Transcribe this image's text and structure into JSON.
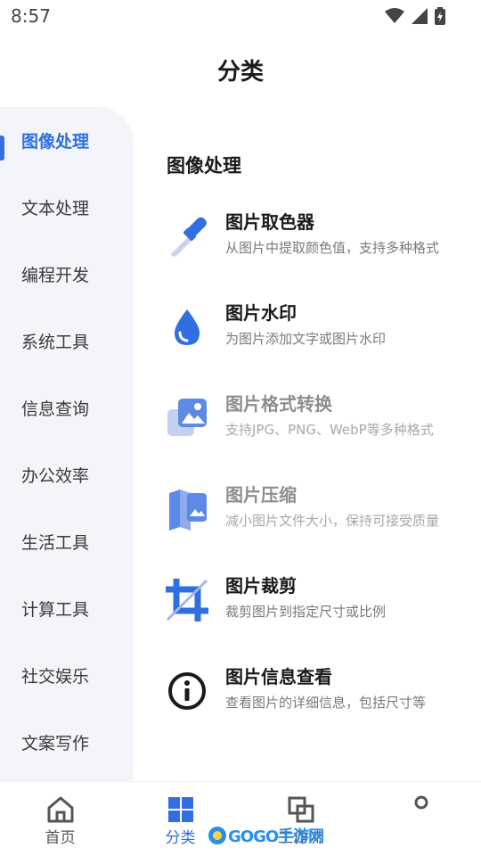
{
  "status_bar": {
    "time": "8:57"
  },
  "header": {
    "title": "分类"
  },
  "sidebar": {
    "items": [
      {
        "label": "图像处理",
        "active": true
      },
      {
        "label": "文本处理"
      },
      {
        "label": "编程开发"
      },
      {
        "label": "系统工具"
      },
      {
        "label": "信息查询"
      },
      {
        "label": "办公效率"
      },
      {
        "label": "生活工具"
      },
      {
        "label": "计算工具"
      },
      {
        "label": "社交娱乐"
      },
      {
        "label": "文案写作"
      }
    ]
  },
  "main": {
    "section_title": "图像处理",
    "tools": [
      {
        "title": "图片取色器",
        "desc": "从图片中提取颜色值，支持多种格式",
        "icon": "color-picker-icon"
      },
      {
        "title": "图片水印",
        "desc": "为图片添加文字或图片水印",
        "icon": "water-drop-icon"
      },
      {
        "title": "图片格式转换",
        "desc": "支持JPG、PNG、WebP等多种格式",
        "icon": "images-icon",
        "dimmed": true
      },
      {
        "title": "图片压缩",
        "desc": "减小图片文件大小，保持可接受质量",
        "icon": "map-image-icon",
        "dimmed": true
      },
      {
        "title": "图片裁剪",
        "desc": "裁剪图片到指定尺寸或比例",
        "icon": "crop-icon"
      },
      {
        "title": "图片信息查看",
        "desc": "查看图片的详细信息，包括尺寸等",
        "icon": "info-icon"
      }
    ]
  },
  "bottom_nav": {
    "items": [
      {
        "label": "首页",
        "icon": "home-icon"
      },
      {
        "label": "分类",
        "icon": "grid-icon",
        "active": true
      },
      {
        "label": "工作流",
        "icon": "workflow-icon"
      },
      {
        "label": "",
        "icon": "profile-icon"
      }
    ]
  },
  "watermark": {
    "text": "GOGO手游网"
  },
  "colors": {
    "accent": "#2f6fe0",
    "sidebar_bg": "#f3f5fb"
  }
}
